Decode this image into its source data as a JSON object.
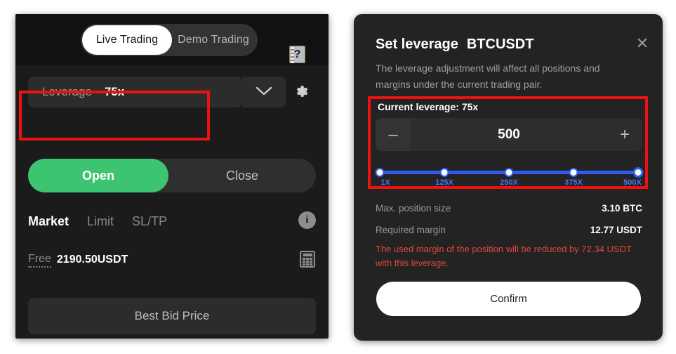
{
  "left_panel": {
    "mode_toggle": {
      "active_label": "Live Trading",
      "inactive_label": "Demo Trading"
    },
    "help_badge": "?",
    "leverage_field": {
      "label": "Leverage",
      "value": "75x"
    },
    "order_side": {
      "open_label": "Open",
      "close_label": "Close"
    },
    "order_tabs": [
      {
        "label": "Market",
        "active": true
      },
      {
        "label": "Limit",
        "active": false
      },
      {
        "label": "SL/TP",
        "active": false
      }
    ],
    "balance": {
      "label": "Free",
      "value": "2190.50USDT"
    },
    "price_button": "Best Bid Price"
  },
  "right_panel": {
    "title": "Set leverage",
    "symbol": "BTCUSDT",
    "description": "The leverage adjustment will affect all positions and margins under the current trading pair.",
    "current_leverage": "Current leverage: 75x",
    "stepper": {
      "decrement": "–",
      "value": "500",
      "increment": "+"
    },
    "slider": {
      "ticks": [
        {
          "label": "1X",
          "pos": 0
        },
        {
          "label": "125X",
          "pos": 25
        },
        {
          "label": "250X",
          "pos": 50
        },
        {
          "label": "375X",
          "pos": 75
        },
        {
          "label": "500X",
          "pos": 100
        }
      ],
      "selected": "500X",
      "fill_color": "#2e5cf0"
    },
    "details": [
      {
        "key": "Max. position size",
        "value": "3.10 BTC"
      },
      {
        "key": "Required margin",
        "value": "12.77 USDT"
      }
    ],
    "warning": "The used margin of the position will be reduced by 72.34 USDT with this leverage.",
    "confirm_label": "Confirm",
    "close_icon": "✕"
  },
  "annotations": {
    "highlight_color": "#ee1111"
  }
}
